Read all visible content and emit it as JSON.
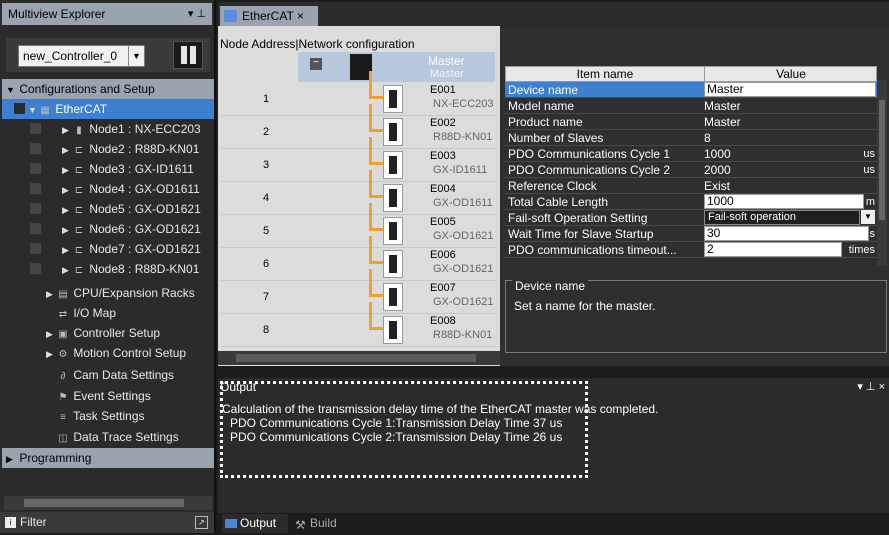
{
  "explorer": {
    "title": "Multiview Explorer",
    "pin": "▾ ⊥",
    "controller": "new_Controller_0",
    "dropdown_arrow": "▼",
    "config_header": "Configurations and Setup",
    "items": [
      {
        "label": "EtherCAT"
      },
      {
        "label": "Node1 : NX-ECC203"
      },
      {
        "label": "Node2 : R88D-KN01"
      },
      {
        "label": "Node3 : GX-ID1611"
      },
      {
        "label": "Node4 : GX-OD1611"
      },
      {
        "label": "Node5 : GX-OD1621"
      },
      {
        "label": "Node6 : GX-OD1621"
      },
      {
        "label": "Node7 : GX-OD1621"
      },
      {
        "label": "Node8 : R88D-KN01"
      },
      {
        "label": "CPU/Expansion Racks"
      },
      {
        "label": "I/O Map"
      },
      {
        "label": "Controller Setup"
      },
      {
        "label": "Motion Control Setup"
      },
      {
        "label": "Cam Data Settings"
      },
      {
        "label": "Event Settings"
      },
      {
        "label": "Task Settings"
      },
      {
        "label": "Data Trace Settings"
      }
    ],
    "programming": "Programming",
    "filter": "Filter"
  },
  "tab": {
    "label": "EtherCAT",
    "close": "×"
  },
  "network": {
    "header": "Node Address|Network configuration",
    "master_title": "Master",
    "master_sub": "Master",
    "nodes": [
      {
        "num": "1",
        "id": "E001",
        "model": "NX-ECC203"
      },
      {
        "num": "2",
        "id": "E002",
        "model": "R88D-KN01"
      },
      {
        "num": "3",
        "id": "E003",
        "model": "GX-ID1611"
      },
      {
        "num": "4",
        "id": "E004",
        "model": "GX-OD1611"
      },
      {
        "num": "5",
        "id": "E005",
        "model": "GX-OD1621"
      },
      {
        "num": "6",
        "id": "E006",
        "model": "GX-OD1621"
      },
      {
        "num": "7",
        "id": "E007",
        "model": "GX-OD1621"
      },
      {
        "num": "8",
        "id": "E008",
        "model": "R88D-KN01"
      }
    ]
  },
  "properties": {
    "col_item": "Item name",
    "col_value": "Value",
    "rows": [
      {
        "k": "Device name",
        "v": "Master",
        "u": ""
      },
      {
        "k": "Model name",
        "v": "Master",
        "u": ""
      },
      {
        "k": "Product name",
        "v": "Master",
        "u": ""
      },
      {
        "k": "Number of Slaves",
        "v": "8",
        "u": ""
      },
      {
        "k": "PDO Communications Cycle 1",
        "v": "1000",
        "u": "us"
      },
      {
        "k": "PDO Communications Cycle 2",
        "v": "2000",
        "u": "us"
      },
      {
        "k": "Reference Clock",
        "v": "Exist",
        "u": ""
      },
      {
        "k": "Total Cable Length",
        "v": "1000",
        "u": "m"
      },
      {
        "k": "Fail-soft Operation Setting",
        "v": "Fail-soft operation",
        "u": ""
      },
      {
        "k": "Wait Time for Slave Startup",
        "v": "30",
        "u": "s"
      },
      {
        "k": "PDO communications timeout...",
        "v": "2",
        "u": "times"
      }
    ],
    "desc_title": "Device name",
    "desc_text": "Set a name for the master."
  },
  "output": {
    "title": "Output",
    "pins": "▾ ⊥ ×",
    "lines": [
      "Calculation of the transmission delay time of the EtherCAT master was completed.",
      "PDO Communications Cycle 1:Transmission Delay Time 37 us",
      "PDO Communications Cycle 2:Transmission Delay Time 26 us"
    ]
  },
  "bottom_tabs": {
    "output": "Output",
    "build": "Build"
  }
}
